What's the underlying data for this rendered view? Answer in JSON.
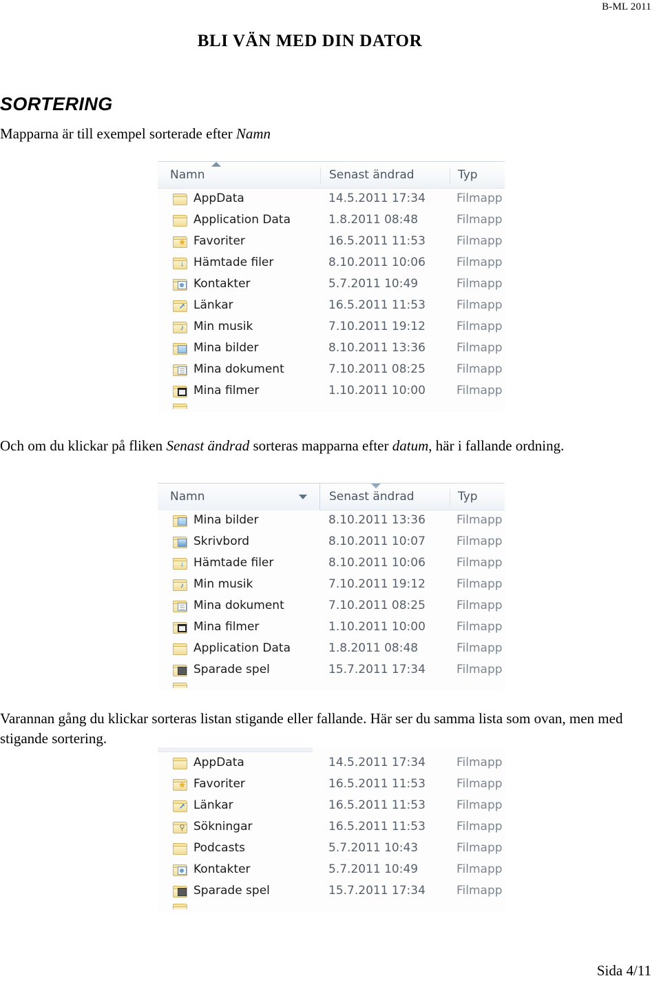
{
  "running_head": "B-ML 2011",
  "doc_title": "BLI VÄN MED DIN DATOR",
  "section_heading": "SORTERING",
  "paragraphs": {
    "p1_before": "Mapparna är till exempel sorterade efter ",
    "p1_italic": "Namn",
    "p2_a": "Och om du klickar på fliken ",
    "p2_i1": "Senast ändrad",
    "p2_b": " sorteras mapparna efter ",
    "p2_i2": "datum",
    "p2_c": ", här i fallande ordning.",
    "p3": "Varannan gång du klickar sorteras listan stigande eller fallande. Här ser du samma lista som ovan, men med stigande sortering."
  },
  "columns": {
    "name": "Namn",
    "modified": "Senast ändrad",
    "type": "Typ"
  },
  "tables": [
    {
      "id": "explorer-sorted-by-name",
      "sort_column": "Namn",
      "sort_direction": "ascending",
      "has_header": true,
      "rows": [
        {
          "name": "AppData",
          "modified": "14.5.2011 17:34",
          "type": "Filmapp",
          "icon": "folder-plain"
        },
        {
          "name": "Application Data",
          "modified": "1.8.2011 08:48",
          "type": "Filmapp",
          "icon": "folder-plain"
        },
        {
          "name": "Favoriter",
          "modified": "16.5.2011 11:53",
          "type": "Filmapp",
          "icon": "folder-star"
        },
        {
          "name": "Hämtade filer",
          "modified": "8.10.2011 10:06",
          "type": "Filmapp",
          "icon": "folder-download"
        },
        {
          "name": "Kontakter",
          "modified": "5.7.2011 10:49",
          "type": "Filmapp",
          "icon": "folder-contact"
        },
        {
          "name": "Länkar",
          "modified": "16.5.2011 11:53",
          "type": "Filmapp",
          "icon": "folder-link"
        },
        {
          "name": "Min musik",
          "modified": "7.10.2011 19:12",
          "type": "Filmapp",
          "icon": "folder-music"
        },
        {
          "name": "Mina bilder",
          "modified": "8.10.2011 13:36",
          "type": "Filmapp",
          "icon": "folder-picture"
        },
        {
          "name": "Mina dokument",
          "modified": "7.10.2011 08:25",
          "type": "Filmapp",
          "icon": "folder-document"
        },
        {
          "name": "Mina filmer",
          "modified": "1.10.2011 10:00",
          "type": "Filmapp",
          "icon": "folder-film"
        }
      ]
    },
    {
      "id": "explorer-sorted-by-date-descending",
      "sort_column": "Senast ändrad",
      "sort_direction": "descending",
      "has_header": true,
      "rows": [
        {
          "name": "Mina bilder",
          "modified": "8.10.2011 13:36",
          "type": "Filmapp",
          "icon": "folder-picture"
        },
        {
          "name": "Skrivbord",
          "modified": "8.10.2011 10:07",
          "type": "Filmapp",
          "icon": "folder-desktop"
        },
        {
          "name": "Hämtade filer",
          "modified": "8.10.2011 10:06",
          "type": "Filmapp",
          "icon": "folder-download"
        },
        {
          "name": "Min musik",
          "modified": "7.10.2011 19:12",
          "type": "Filmapp",
          "icon": "folder-music"
        },
        {
          "name": "Mina dokument",
          "modified": "7.10.2011 08:25",
          "type": "Filmapp",
          "icon": "folder-document"
        },
        {
          "name": "Mina filmer",
          "modified": "1.10.2011 10:00",
          "type": "Filmapp",
          "icon": "folder-film"
        },
        {
          "name": "Application Data",
          "modified": "1.8.2011 08:48",
          "type": "Filmapp",
          "icon": "folder-plain"
        },
        {
          "name": "Sparade spel",
          "modified": "15.7.2011 17:34",
          "type": "Filmapp",
          "icon": "folder-game"
        }
      ]
    },
    {
      "id": "explorer-sorted-by-date-ascending",
      "sort_column": "Senast ändrad",
      "sort_direction": "ascending",
      "has_header": false,
      "rows": [
        {
          "name": "AppData",
          "modified": "14.5.2011 17:34",
          "type": "Filmapp",
          "icon": "folder-plain"
        },
        {
          "name": "Favoriter",
          "modified": "16.5.2011 11:53",
          "type": "Filmapp",
          "icon": "folder-star"
        },
        {
          "name": "Länkar",
          "modified": "16.5.2011 11:53",
          "type": "Filmapp",
          "icon": "folder-link"
        },
        {
          "name": "Sökningar",
          "modified": "16.5.2011 11:53",
          "type": "Filmapp",
          "icon": "folder-search"
        },
        {
          "name": "Podcasts",
          "modified": "5.7.2011 10:43",
          "type": "Filmapp",
          "icon": "folder-plain"
        },
        {
          "name": "Kontakter",
          "modified": "5.7.2011 10:49",
          "type": "Filmapp",
          "icon": "folder-contact"
        },
        {
          "name": "Sparade spel",
          "modified": "15.7.2011 17:34",
          "type": "Filmapp",
          "icon": "folder-game"
        }
      ]
    }
  ],
  "footer": "Sida 4/11"
}
